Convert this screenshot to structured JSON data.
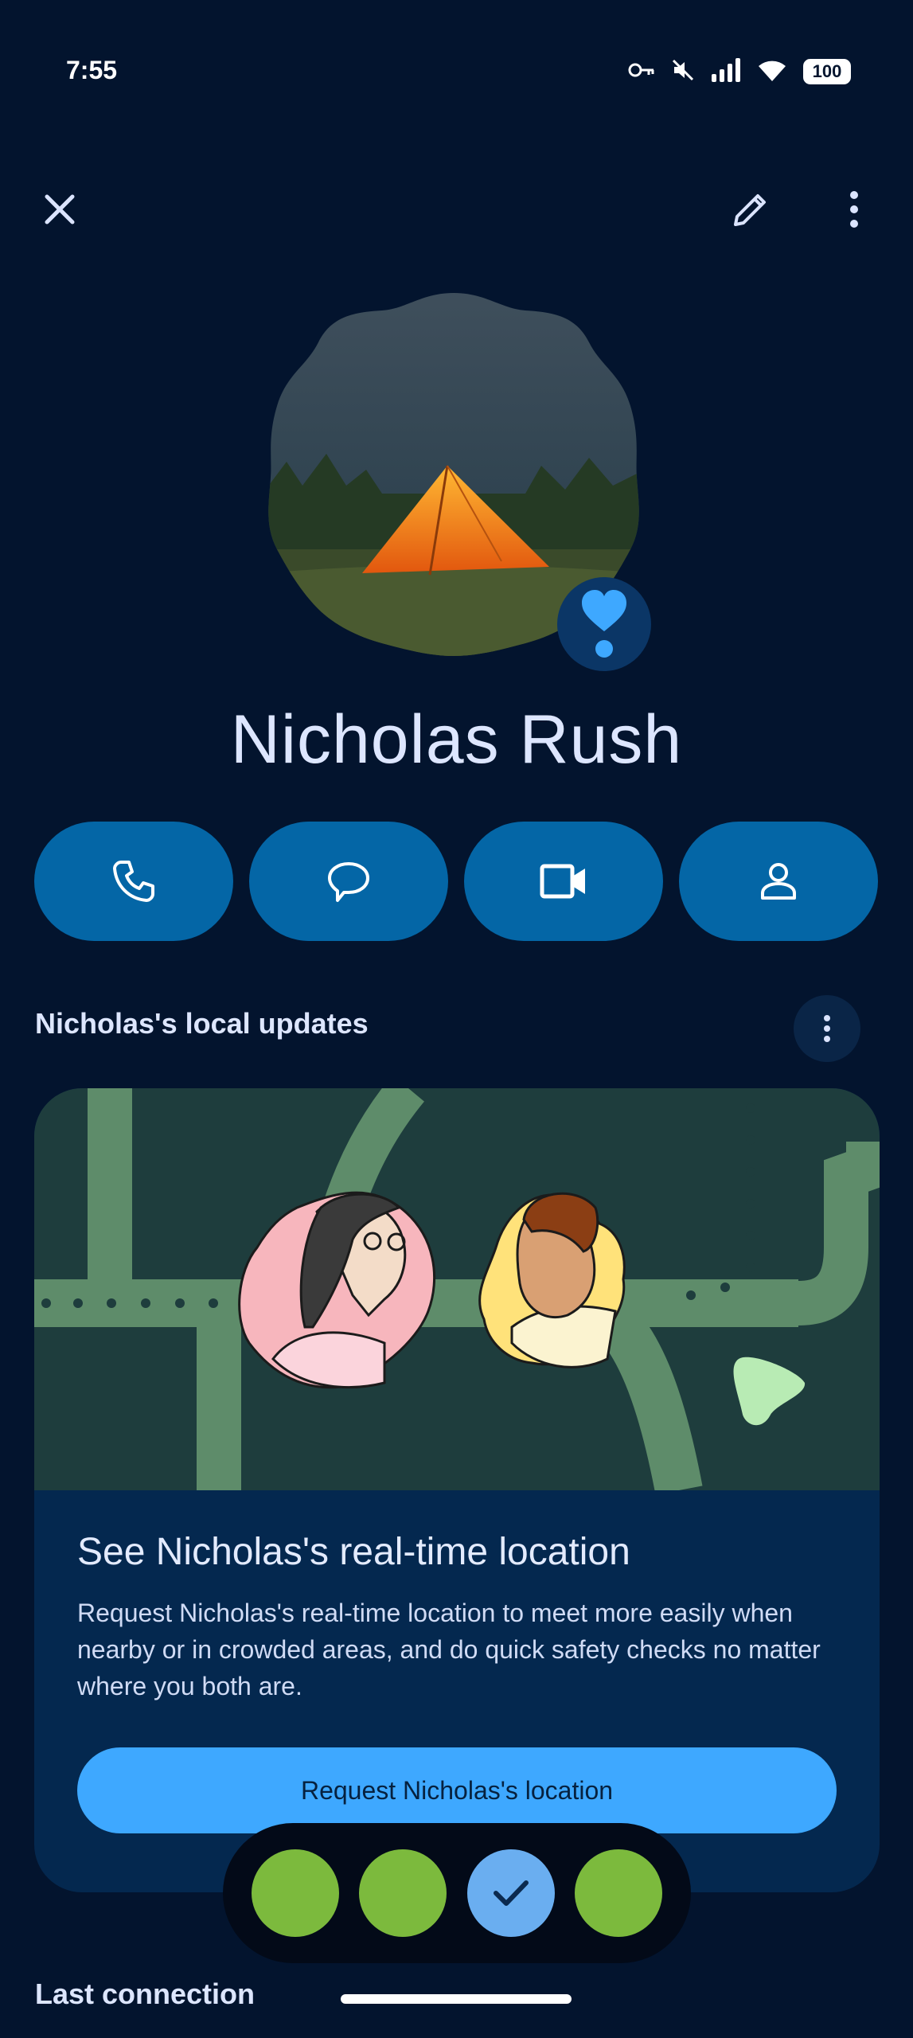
{
  "status_bar": {
    "time": "7:55",
    "battery": "100",
    "icons": [
      "vpn-key-icon",
      "mute-icon",
      "signal-icon",
      "wifi-icon",
      "battery-icon"
    ]
  },
  "top_bar": {
    "close_icon": "close-icon",
    "edit_icon": "pencil-icon",
    "more_icon": "more-vert-icon"
  },
  "contact": {
    "name": "Nicholas Rush",
    "favorite_icon": "heart-exclamation-icon"
  },
  "actions": [
    {
      "name": "call",
      "icon": "phone-icon"
    },
    {
      "name": "message",
      "icon": "chat-icon"
    },
    {
      "name": "video",
      "icon": "video-icon"
    },
    {
      "name": "profile",
      "icon": "person-icon"
    }
  ],
  "updates": {
    "title": "Nicholas's local updates"
  },
  "location_card": {
    "title": "See Nicholas's real-time location",
    "description": "Request Nicholas's real-time location to meet more easily when nearby or in crowded areas, and do quick safety checks no matter where you both are.",
    "button_label": "Request Nicholas's location"
  },
  "dock": {
    "bubbles": [
      {
        "state": "default"
      },
      {
        "state": "default"
      },
      {
        "state": "selected",
        "icon": "check-icon"
      },
      {
        "state": "default"
      }
    ]
  },
  "last_connection": {
    "title": "Last connection"
  },
  "colors": {
    "background": "#03142e",
    "action_button": "#0466a6",
    "primary_button": "#3ea8ff",
    "card": "#04284f",
    "bubble": "#7cba3d"
  }
}
